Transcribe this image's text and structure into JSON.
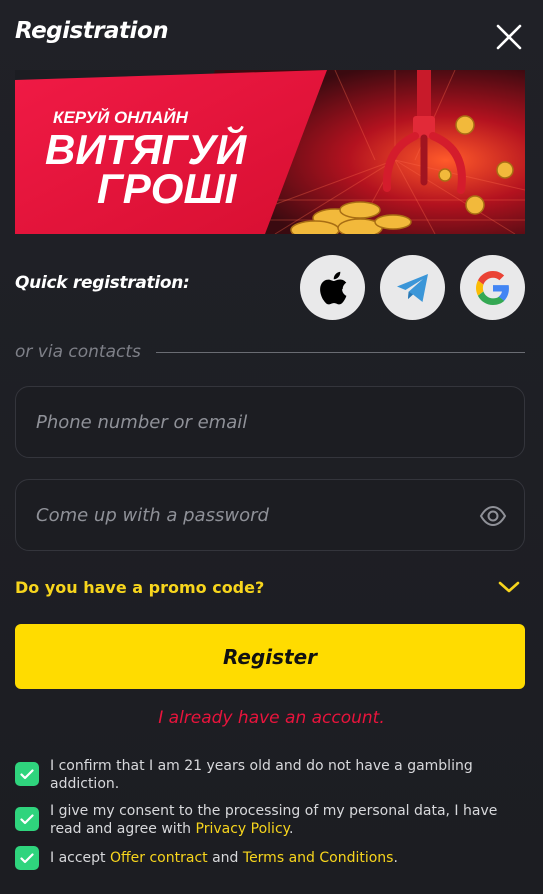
{
  "header": {
    "title": "Registration"
  },
  "banner": {
    "line1": "КЕРУЙ ОНЛАЙН",
    "line2": "ВИТЯГУЙ",
    "line3": "ГРОШІ",
    "colors": {
      "red": "#e8163a",
      "dark_red": "#7a0c14"
    }
  },
  "quick_registration": {
    "label": "Quick registration:",
    "providers": [
      {
        "name": "apple",
        "icon": "apple-icon"
      },
      {
        "name": "telegram",
        "icon": "telegram-icon"
      },
      {
        "name": "google",
        "icon": "google-icon"
      }
    ]
  },
  "divider": {
    "label": "or via contacts"
  },
  "form": {
    "login_placeholder": "Phone number or email",
    "login_value": "",
    "password_placeholder": "Come up with a password",
    "password_value": "",
    "promo_label": "Do you have a promo code?",
    "register_label": "Register",
    "login_link": "I already have an account."
  },
  "consents": [
    {
      "checked": true,
      "text": "I confirm that I am 21 years old and do not have a gambling addiction."
    },
    {
      "checked": true,
      "text_before": "I give my consent to the processing of my personal data, I have read and agree with ",
      "link": "Privacy Policy",
      "text_after": "."
    },
    {
      "checked": true,
      "text_before": "I accept ",
      "link1": "Offer contract",
      "text_middle": " and ",
      "link2": "Terms and Conditions",
      "text_after": "."
    }
  ],
  "colors": {
    "background": "#1c1d22",
    "accent_yellow": "#ffdc00",
    "accent_red": "#e8143c",
    "check_green": "#2fd47d"
  }
}
